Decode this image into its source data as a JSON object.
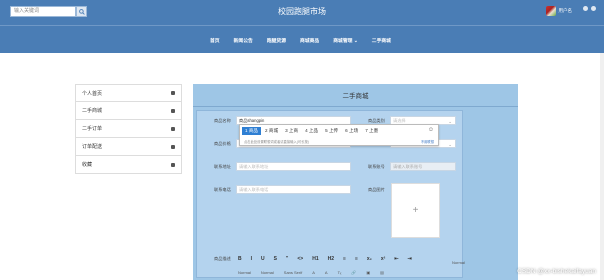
{
  "header": {
    "search_placeholder": "输入关键词",
    "site_title": "校园跑腿市场",
    "username": "用户名"
  },
  "nav": {
    "items": [
      "首页",
      "新闻公告",
      "跑腿货源",
      "商城商品",
      "商城管理 ⌄",
      "二手商城"
    ]
  },
  "sidebar": {
    "items": [
      "个人首页",
      "二手商城",
      "二手订单",
      "订单配送",
      "收藏"
    ]
  },
  "main": {
    "title": "二手商城",
    "form": {
      "name_label": "商品名称",
      "name_value": "商品shangpin",
      "category_label": "商品类别",
      "category_placeholder": "请选择",
      "price_label": "商品价格",
      "price_placeholder": "请输入",
      "row3_right_label": "商品价格",
      "buyer_label": "联系地址",
      "buyer_placeholder": "请输入联系地址",
      "seller_label": "联系账号",
      "seller_placeholder": "请输入联系账号",
      "phone_label": "联系电话",
      "phone_placeholder": "请输入联系电话",
      "image_label": "商品图片",
      "desc_label": "商品描述"
    }
  },
  "ime": {
    "candidates": [
      "1 商品",
      "2 商城",
      "3 上商",
      "4 上品",
      "5 上传",
      "6 上场",
      "7 上墨"
    ],
    "hint": "点击此处设置联想词或者请直接输入(可长按)",
    "more": "不用联想"
  },
  "editor": {
    "buttons": [
      "B",
      "I",
      "U",
      "S",
      "\"",
      "<>",
      "H1",
      "H2",
      "≡",
      "≡",
      "x₂",
      "x²",
      "⇤",
      "⇥"
    ],
    "row2": [
      "Normal",
      "Normal",
      "Sans Serif",
      "A",
      "A",
      "Tₓ",
      "🔗",
      "▣",
      "▤"
    ],
    "style_label": "Normal"
  },
  "watermark": "CSDN @xx-bishekaifayuan"
}
